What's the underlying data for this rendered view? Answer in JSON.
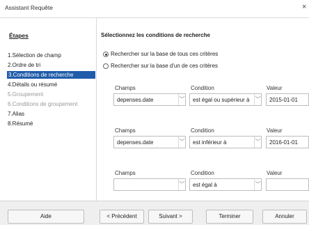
{
  "window": {
    "title": "Assistant Requête",
    "close_glyph": "×"
  },
  "steps": {
    "title": "Étapes",
    "items": [
      {
        "label": "1.Sélection de champ",
        "state": "normal"
      },
      {
        "label": "2.Ordre de tri",
        "state": "normal"
      },
      {
        "label": "3.Conditions de recherche",
        "state": "selected"
      },
      {
        "label": "4.Détails ou résumé",
        "state": "normal"
      },
      {
        "label": "5.Groupement",
        "state": "disabled"
      },
      {
        "label": "6.Conditions de groupement",
        "state": "disabled"
      },
      {
        "label": "7.Alias",
        "state": "normal"
      },
      {
        "label": "8.Résumé",
        "state": "normal"
      }
    ]
  },
  "main": {
    "heading": "Sélectionnez les conditions de recherche",
    "radio_all": "Rechercher sur la base de tous ces critères",
    "radio_any": "Rechercher sur la base d'un de ces critères",
    "selected_radio": "all",
    "rows": [
      {
        "champs_label": "Champs",
        "condition_label": "Condition",
        "valeur_label": "Valeur",
        "champs_value": "depenses.date",
        "condition_value": "est égal ou supérieur à",
        "valeur_value": "2015-01-01"
      },
      {
        "champs_label": "Champs",
        "condition_label": "Condition",
        "valeur_label": "Valeur",
        "champs_value": "depenses.date",
        "condition_value": "est inférieur à",
        "valeur_value": "2016-01-01"
      },
      {
        "champs_label": "Champs",
        "condition_label": "Condition",
        "valeur_label": "Valeur",
        "champs_value": "",
        "condition_value": "est égal à",
        "valeur_value": ""
      }
    ]
  },
  "footer": {
    "aide": "Aide",
    "precedent": "< Précédent",
    "suivant": "Suivant >",
    "terminer": "Terminer",
    "annuler": "Annuler"
  }
}
